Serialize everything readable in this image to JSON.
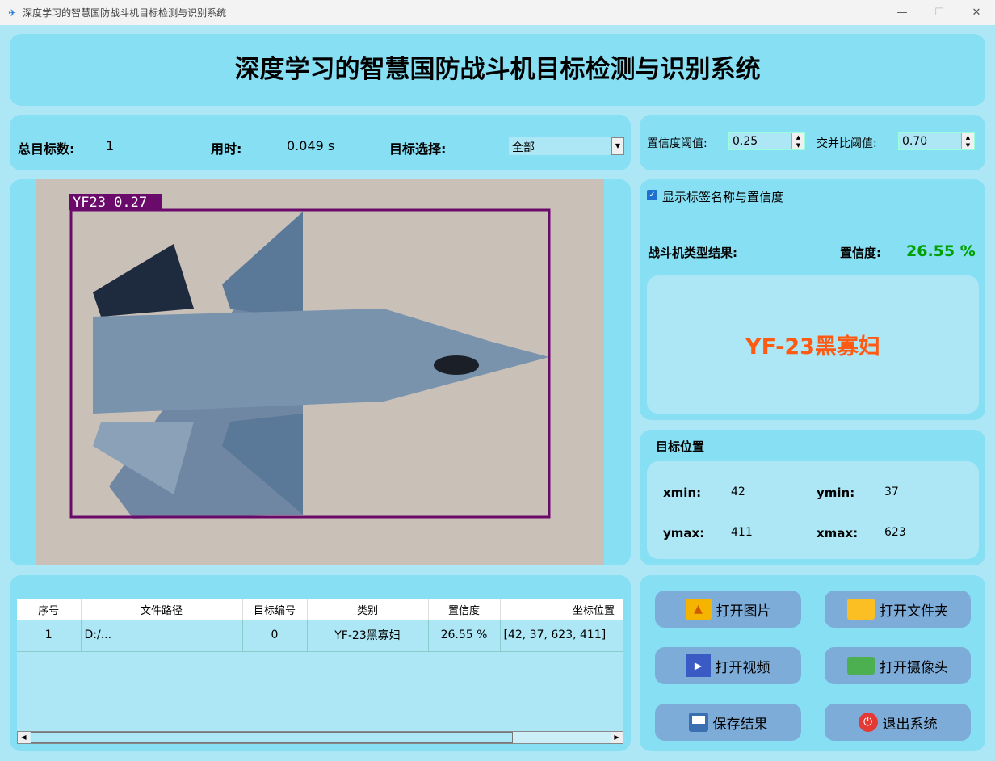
{
  "window": {
    "title": "深度学习的智慧国防战斗机目标检测与识别系统"
  },
  "header": {
    "title": "深度学习的智慧国防战斗机目标检测与识别系统"
  },
  "stats": {
    "total_label": "总目标数:",
    "total_value": "1",
    "time_label": "用时:",
    "time_value": "0.049 s",
    "select_label": "目标选择:",
    "select_value": "全部"
  },
  "thresholds": {
    "conf_label": "置信度阈值:",
    "conf_value": "0.25",
    "iou_label": "交并比阈值:",
    "iou_value": "0.70"
  },
  "image": {
    "box_label": "YF23 0.27"
  },
  "result": {
    "show_label": "显示标签名称与置信度",
    "show_checked": true,
    "type_label": "战斗机类型结果:",
    "conf_label": "置信度:",
    "conf_value": "26.55 %",
    "class_name": "YF-23黑寡妇"
  },
  "position": {
    "title": "目标位置",
    "xmin_label": "xmin:",
    "xmin": "42",
    "ymin_label": "ymin:",
    "ymin": "37",
    "ymax_label": "ymax:",
    "ymax": "411",
    "xmax_label": "xmax:",
    "xmax": "623"
  },
  "table": {
    "headers": [
      "序号",
      "文件路径",
      "目标编号",
      "类别",
      "置信度",
      "坐标位置"
    ],
    "rows": [
      [
        "1",
        "D:/...",
        "0",
        "YF-23黑寡妇",
        "26.55 %",
        "[42, 37, 623, 411]"
      ]
    ]
  },
  "buttons": {
    "open_image": "打开图片",
    "open_folder": "打开文件夹",
    "open_video": "打开视频",
    "open_camera": "打开摄像头",
    "save": "保存结果",
    "exit": "退出系统"
  },
  "colors": {
    "accent_green": "#00a000",
    "result_orange": "#ff5a14",
    "box": "#6a0a6a"
  }
}
